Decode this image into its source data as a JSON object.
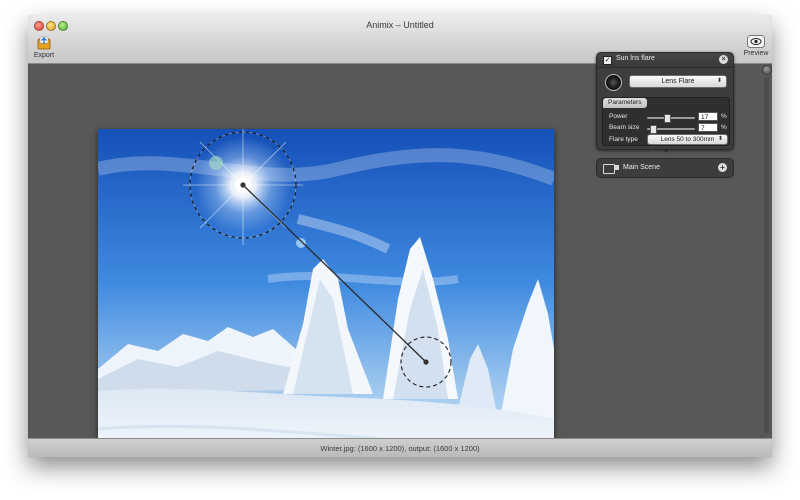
{
  "window": {
    "title": "Animix – Untitled"
  },
  "toolbar": {
    "export_label": "Export",
    "preview_label": "Preview"
  },
  "status": {
    "text": "Winter.jpg: (1600 x 1200), output: (1600 x 1200)"
  },
  "effect_panel": {
    "enabled": true,
    "title": "Sun lns flare",
    "effect_select": "Lens Flare",
    "parameters_tab": "Parameters",
    "power": {
      "label": "Power",
      "value": "17",
      "unit": "%",
      "level": 0.17
    },
    "beam_size": {
      "label": "Beam size",
      "value": "7",
      "unit": "%",
      "level": 0.07
    },
    "flare_type": {
      "label": "Flare type",
      "value": "Lens 50 to 300mm"
    }
  },
  "scene_panel": {
    "label": "Main Scene"
  },
  "colors": {
    "sky": "#2a6fd0",
    "snow": "#ffffff",
    "panel": "#3d3d3d",
    "canvas_bg": "#585858"
  },
  "icons": [
    "close-icon",
    "minimize-icon",
    "maximize-icon",
    "export-icon",
    "preview-eye-icon",
    "lens-icon",
    "remove-effect-icon",
    "scene-icon",
    "add-effect-icon"
  ]
}
